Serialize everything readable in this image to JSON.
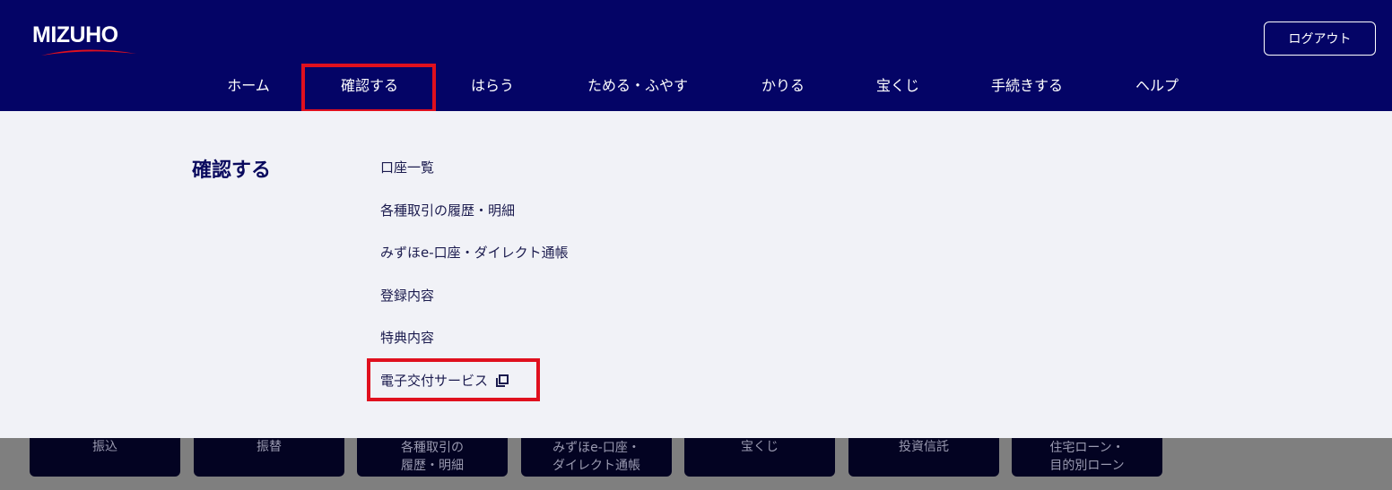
{
  "header": {
    "logo_text": "MIZUHO",
    "logout_label": "ログアウト"
  },
  "gnav": {
    "items": [
      {
        "label": "ホーム"
      },
      {
        "label": "確認する"
      },
      {
        "label": "はらう"
      },
      {
        "label": "ためる・ふやす"
      },
      {
        "label": "かりる"
      },
      {
        "label": "宝くじ"
      },
      {
        "label": "手続きする"
      },
      {
        "label": "ヘルプ"
      }
    ],
    "active_index": 1
  },
  "dropdown": {
    "title": "確認する",
    "links": [
      {
        "label": "口座一覧"
      },
      {
        "label": "各種取引の履歴・明細"
      },
      {
        "label": "みずほe-口座・ダイレクト通帳"
      },
      {
        "label": "登録内容"
      },
      {
        "label": "特典内容"
      },
      {
        "label": "電子交付サービス",
        "icon": "external-window-icon"
      }
    ]
  },
  "tiles": [
    {
      "line1": "振込",
      "line2": ""
    },
    {
      "line1": "振替",
      "line2": ""
    },
    {
      "line1": "各種取引の",
      "line2": "履歴・明細"
    },
    {
      "line1": "みずほe-口座・",
      "line2": "ダイレクト通帳"
    },
    {
      "line1": "宝くじ",
      "line2": ""
    },
    {
      "line1": "投資信託",
      "line2": ""
    },
    {
      "line1": "住宅ローン・",
      "line2": "目的別ローン"
    }
  ],
  "colors": {
    "header_bg": "#040466",
    "panel_bg": "#f1f2f7",
    "highlight": "#e0101e",
    "logo_swoosh": "#e0101e"
  }
}
